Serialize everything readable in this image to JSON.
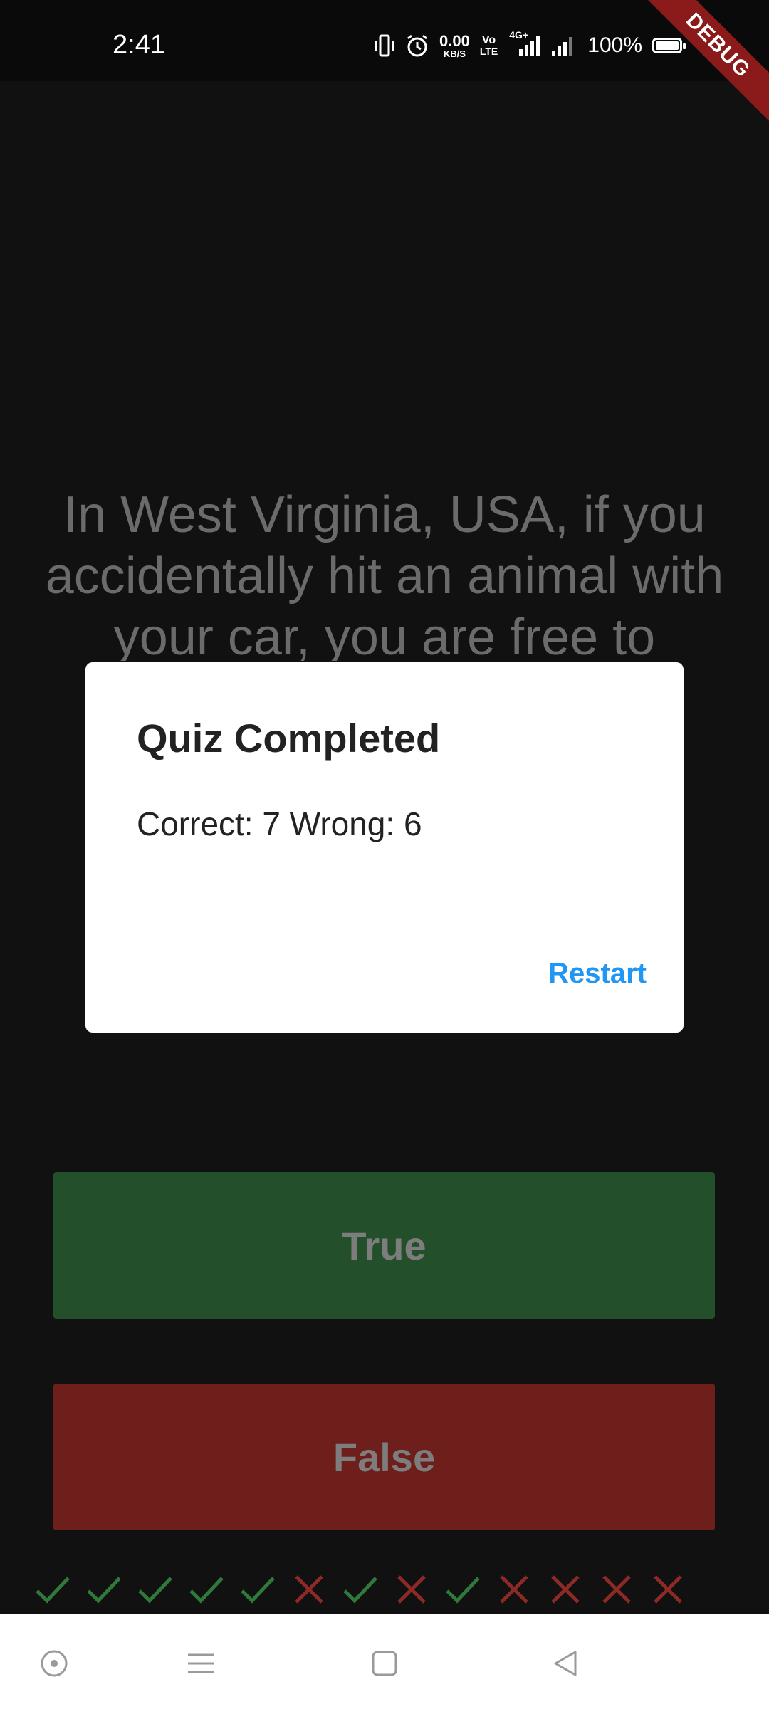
{
  "status_bar": {
    "time": "2:41",
    "net_speed_value": "0.00",
    "net_speed_unit": "KB/S",
    "volte_top": "Vo",
    "volte_bottom": "LTE",
    "network_type": "4G+",
    "battery_percent": "100%",
    "battery_level": 1.0,
    "icons": [
      "vibrate-icon",
      "alarm-icon",
      "signal-4g-icon",
      "signal-icon",
      "battery-icon"
    ]
  },
  "debug_banner": "DEBUG",
  "question": {
    "text": "In West Virginia, USA, if you accidentally hit an animal with your car, you are free to"
  },
  "buttons": {
    "true_label": "True",
    "false_label": "False"
  },
  "score_marks": [
    "check",
    "check",
    "check",
    "check",
    "check",
    "cross",
    "check",
    "cross",
    "check",
    "cross",
    "cross",
    "cross",
    "cross"
  ],
  "dialog": {
    "title": "Quiz Completed",
    "body": "Correct: 7 Wrong: 6",
    "action": "Restart"
  },
  "colors": {
    "background": "#111111",
    "true_button": "#23502a",
    "false_button": "#6f1f1b",
    "check": "#2f7a3a",
    "cross": "#8e2a26",
    "accent": "#2196f3"
  },
  "nav": {
    "icons": [
      "assistant-icon",
      "menu-icon",
      "home-icon",
      "back-icon"
    ]
  }
}
